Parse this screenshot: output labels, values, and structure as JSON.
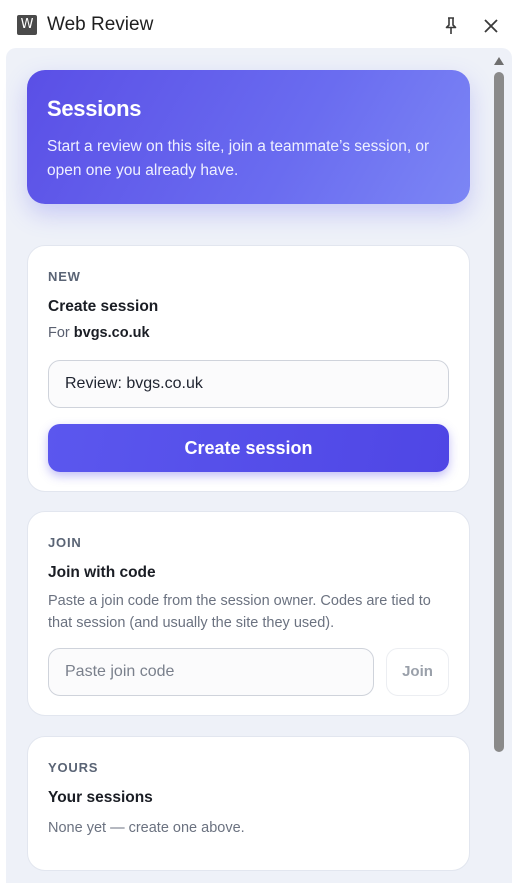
{
  "window": {
    "app_icon_letter": "W",
    "title": "Web Review",
    "pin_icon": "pin-icon",
    "close_icon": "close-icon"
  },
  "hero": {
    "title": "Sessions",
    "subtitle": "Start a review on this site, join a teammate’s session, or open one you already have."
  },
  "new_card": {
    "label": "NEW",
    "heading": "Create session",
    "for_prefix": "For",
    "site": "bvgs.co.uk",
    "name_value": "Review: bvgs.co.uk",
    "button_label": "Create session"
  },
  "join_card": {
    "label": "JOIN",
    "heading": "Join with code",
    "description": "Paste a join code from the session owner. Codes are tied to that session (and usually the site they used).",
    "code_placeholder": "Paste join code",
    "button_label": "Join"
  },
  "yours_card": {
    "label": "YOURS",
    "heading": "Your sessions",
    "empty_text": "None yet — create one above."
  },
  "colors": {
    "accent": "#4f46e5",
    "hero_gradient_start": "#5a4fe6",
    "hero_gradient_end": "#7c86f5",
    "panel_bg": "#eef1f8"
  }
}
